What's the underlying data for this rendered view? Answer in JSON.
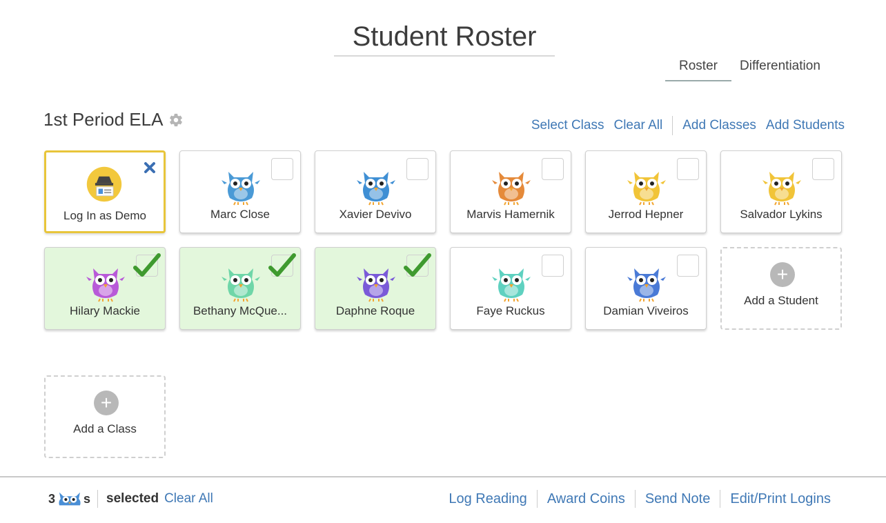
{
  "header": {
    "title": "Student Roster"
  },
  "view_tabs": [
    {
      "label": "Roster",
      "active": true
    },
    {
      "label": "Differentiation",
      "active": false
    }
  ],
  "class": {
    "name": "1st Period ELA",
    "actions": {
      "select_class": "Select Class",
      "clear_all": "Clear All",
      "add_classes": "Add Classes",
      "add_students": "Add Students"
    }
  },
  "demo_card": {
    "label": "Log In as Demo"
  },
  "students": [
    {
      "name": "Marc Close",
      "selected": false,
      "owl_color": "#4a9ad6"
    },
    {
      "name": "Xavier Devivo",
      "selected": false,
      "owl_color": "#3f8fd4"
    },
    {
      "name": "Marvis Hamernik",
      "selected": false,
      "owl_color": "#e58a3a"
    },
    {
      "name": "Jerrod Hepner",
      "selected": false,
      "owl_color": "#f1c438"
    },
    {
      "name": "Salvador Lykins",
      "selected": false,
      "owl_color": "#f1c438"
    },
    {
      "name": "Hilary Mackie",
      "selected": true,
      "owl_color": "#b85ad8"
    },
    {
      "name": "Bethany McQue...",
      "selected": true,
      "owl_color": "#6fd6a8"
    },
    {
      "name": "Daphne Roque",
      "selected": true,
      "owl_color": "#7a5ad8"
    },
    {
      "name": "Faye Ruckus",
      "selected": false,
      "owl_color": "#5fd1c0"
    },
    {
      "name": "Damian Viveiros",
      "selected": false,
      "owl_color": "#4a7ad6"
    }
  ],
  "add_student": {
    "label": "Add a Student"
  },
  "add_class": {
    "label": "Add a Class"
  },
  "footer": {
    "selected_count": "3",
    "owl_suffix": "s",
    "selected_label": "selected",
    "clear_all": "Clear All",
    "actions": [
      "Log Reading",
      "Award Coins",
      "Send Note",
      "Edit/Print Logins"
    ]
  },
  "colors": {
    "link": "#3f78b5",
    "selected_bg": "#e3f7dc",
    "check": "#3f9a2f",
    "demo_border": "#e8c53a"
  }
}
